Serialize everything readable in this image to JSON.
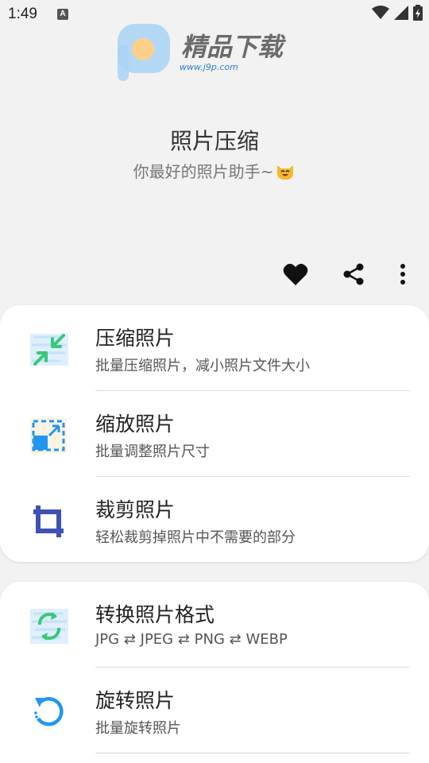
{
  "status_bar": {
    "time": "1:49",
    "notification_label": "A"
  },
  "watermark": {
    "brand_text": "精品下载",
    "url_text": "www.j9p.com"
  },
  "header": {
    "title": "照片压缩",
    "subtitle": "你最好的照片助手~"
  },
  "actions": {
    "favorite_icon": "heart-icon",
    "share_icon": "share-icon",
    "more_icon": "more-vert-icon"
  },
  "features_group_1": [
    {
      "title": "压缩照片",
      "desc": "批量压缩照片，减小照片文件大小",
      "icon": "compress-icon"
    },
    {
      "title": "缩放照片",
      "desc": "批量调整照片尺寸",
      "icon": "resize-icon"
    },
    {
      "title": "裁剪照片",
      "desc": "轻松裁剪掉照片中不需要的部分",
      "icon": "crop-icon"
    }
  ],
  "features_group_2": [
    {
      "title": "转换照片格式",
      "desc": "JPG ⇄ JPEG ⇄ PNG ⇄ WEBP",
      "icon": "convert-icon"
    },
    {
      "title": "旋转照片",
      "desc": "批量旋转照片",
      "icon": "rotate-icon"
    }
  ],
  "colors": {
    "background": "#f2f2f2",
    "card": "#ffffff",
    "accent_blue": "#2196f3",
    "accent_green": "#4cd97b",
    "crop_blue": "#3f51b5"
  }
}
